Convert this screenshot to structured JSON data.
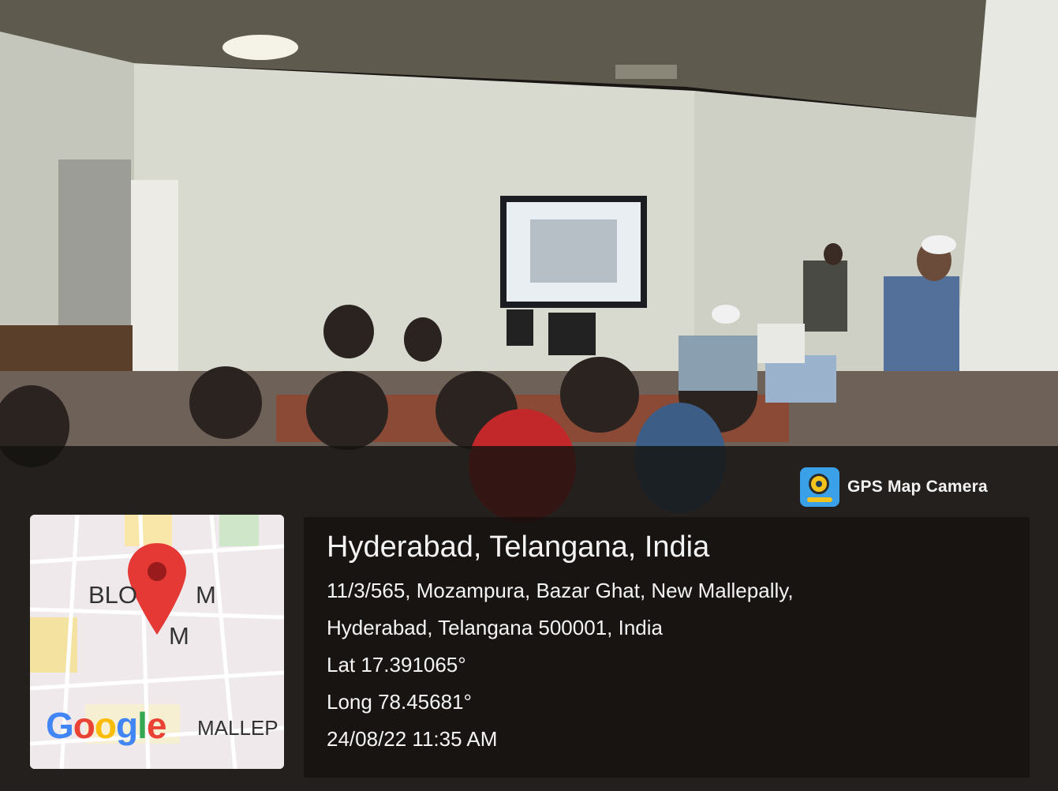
{
  "badge": {
    "label": "GPS Map Camera",
    "icon": "gps-map-camera-app-icon"
  },
  "map": {
    "labels": [
      "BLO",
      "M",
      "M",
      "MALLEP"
    ],
    "logo": "Google",
    "pin_color": "#e53935"
  },
  "location": {
    "city": "Hyderabad, Telangana, India",
    "address_line1": "11/3/565, Mozampura, Bazar Ghat, New Mallepally,",
    "address_line2": "Hyderabad, Telangana 500001, India",
    "lat": "Lat 17.391065°",
    "long": "Long 78.45681°",
    "datetime": "24/08/22 11:35 AM"
  }
}
